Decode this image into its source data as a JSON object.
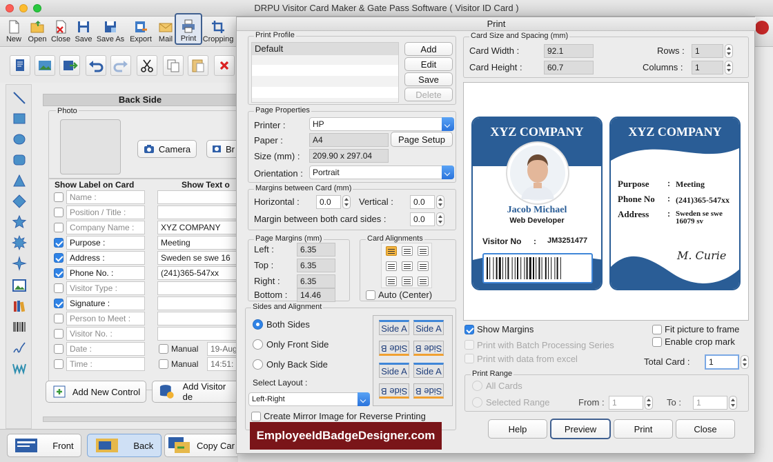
{
  "window": {
    "title": "DRPU Visitor Card Maker & Gate Pass Software ( Visitor ID Card )"
  },
  "toolbar": {
    "items": [
      {
        "label": "New",
        "icon": "new-document-icon"
      },
      {
        "label": "Open",
        "icon": "open-folder-icon"
      },
      {
        "label": "Close",
        "icon": "close-document-icon"
      },
      {
        "label": "Save",
        "icon": "save-icon"
      },
      {
        "label": "Save As",
        "icon": "save-as-icon"
      },
      {
        "label": "Export",
        "icon": "export-icon"
      },
      {
        "label": "Mail",
        "icon": "mail-icon"
      },
      {
        "label": "Print",
        "icon": "printer-icon"
      },
      {
        "label": "Cropping",
        "icon": "crop-icon"
      }
    ]
  },
  "panel": {
    "title": "Back Side",
    "photo_label": "Photo",
    "camera_label": "Camera",
    "browse_label": "Br",
    "show_label_heading": "Show Label on Card",
    "show_text_heading": "Show Text o",
    "rows": [
      {
        "label": "Name :",
        "checked": false,
        "value": ""
      },
      {
        "label": "Position / Title :",
        "checked": false,
        "value": ""
      },
      {
        "label": "Company Name :",
        "checked": false,
        "value": "XYZ COMPANY"
      },
      {
        "label": "Purpose :",
        "checked": true,
        "value": "Meeting"
      },
      {
        "label": "Address :",
        "checked": true,
        "value": "Sweden se swe 16"
      },
      {
        "label": "Phone No. :",
        "checked": true,
        "value": "(241)365-547xx"
      },
      {
        "label": "Visitor Type :",
        "checked": false,
        "value": ""
      },
      {
        "label": "Signature :",
        "checked": true,
        "value": ""
      },
      {
        "label": "Person to Meet :",
        "checked": false,
        "value": ""
      },
      {
        "label": "Visitor No. :",
        "checked": false,
        "value": ""
      },
      {
        "label": "Date :",
        "checked": false,
        "value": ""
      },
      {
        "label": "Time :",
        "checked": false,
        "value": ""
      }
    ],
    "manual_label": "Manual",
    "date_value": "19-Aug",
    "time_value": "14:51:",
    "add_control_label": "Add New Control",
    "add_visitor_label": "Add Visitor de"
  },
  "bottom": {
    "front_label": "Front",
    "back_label": "Back",
    "copy_label": "Copy Car"
  },
  "dialog": {
    "title": "Print",
    "print_profile": {
      "legend": "Print Profile",
      "items": [
        "Default"
      ],
      "add": "Add",
      "edit": "Edit",
      "save": "Save",
      "delete": "Delete"
    },
    "page_properties": {
      "legend": "Page Properties",
      "printer_label": "Printer :",
      "printer_value": "HP",
      "paper_label": "Paper :",
      "paper_value": "A4",
      "page_setup": "Page Setup",
      "size_label": "Size (mm) :",
      "size_value": "209.90 x 297.04",
      "orientation_label": "Orientation :",
      "orientation_value": "Portrait"
    },
    "margins_card": {
      "legend": "Margins between Card (mm)",
      "horizontal_label": "Horizontal :",
      "horizontal_value": "0.0",
      "vertical_label": "Vertical :",
      "vertical_value": "0.0",
      "both_label": "Margin between both card sides :",
      "both_value": "0.0"
    },
    "page_margins": {
      "legend": "Page Margins (mm)",
      "left_label": "Left :",
      "left_value": "6.35",
      "top_label": "Top :",
      "top_value": "6.35",
      "right_label": "Right :",
      "right_value": "6.35",
      "bottom_label": "Bottom :",
      "bottom_value": "14.46"
    },
    "card_alignments": {
      "legend": "Card Alignments",
      "auto_label": "Auto (Center)"
    },
    "sides": {
      "legend": "Sides and Alignment",
      "both": "Both Sides",
      "front": "Only Front Side",
      "back": "Only Back Side",
      "layout_label": "Select Layout :",
      "layout_value": "Left-Right",
      "side_a": "Side A",
      "side_b": "Side B",
      "mirror_label": "Create Mirror Image for Reverse Printing"
    },
    "card_size": {
      "legend": "Card Size and Spacing (mm)",
      "width_label": "Card Width :",
      "width_value": "92.1",
      "height_label": "Card Height :",
      "height_value": "60.7",
      "rows_label": "Rows :",
      "rows_value": "1",
      "columns_label": "Columns :",
      "columns_value": "1"
    },
    "preview_card": {
      "company": "XYZ COMPANY",
      "name": "Jacob Michael",
      "position": "Web Developer",
      "visitor_no_label": "Visitor No",
      "visitor_no_value": "JM3251477",
      "purpose_label": "Purpose",
      "purpose_value": "Meeting",
      "phone_label": "Phone No",
      "phone_value": "(241)365-547xx",
      "address_label": "Address",
      "address_value": "Sweden se swe 16079 sv",
      "colon": ":",
      "signature": "M. Curie"
    },
    "options": {
      "show_margins": "Show Margins",
      "batch": "Print with Batch Processing Series",
      "excel": "Print with data from excel",
      "fit": "Fit picture to frame",
      "crop": "Enable crop mark",
      "total_label": "Total Card :",
      "total_value": "1"
    },
    "print_range": {
      "legend": "Print Range",
      "all": "All Cards",
      "selected": "Selected Range",
      "from_label": "From :",
      "from_value": "1",
      "to_label": "To :",
      "to_value": "1"
    },
    "buttons": {
      "help": "Help",
      "preview": "Preview",
      "print": "Print",
      "close": "Close"
    }
  },
  "watermark": "EmployeeIdBadgeDesigner.com",
  "colors": {
    "card_blue": "#2a5d96",
    "accent": "#2f83e6",
    "watermark_bg": "#7a1519"
  }
}
